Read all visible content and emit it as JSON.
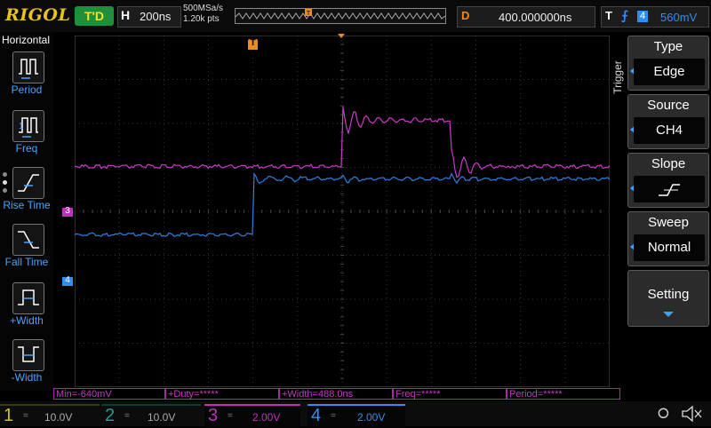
{
  "header": {
    "brand": "RIGOL",
    "run_status": "T'D",
    "timebase_label": "H",
    "timebase_value": "200ns",
    "sample_rate": "500MSa/s",
    "memory_depth": "1.20k pts",
    "delay_label": "D",
    "delay_value": "400.000000ns",
    "trigger_label": "T",
    "trigger_source_badge": "4",
    "trigger_level": "560mV"
  },
  "left_menu": {
    "title": "Horizontal",
    "items": [
      {
        "label": "Period",
        "icon": "period-icon"
      },
      {
        "label": "Freq",
        "icon": "frequency-icon"
      },
      {
        "label": "Rise Time",
        "icon": "rise-time-icon"
      },
      {
        "label": "Fall Time",
        "icon": "fall-time-icon"
      },
      {
        "label": "+Width",
        "icon": "positive-width-icon"
      },
      {
        "label": "-Width",
        "icon": "negative-width-icon"
      }
    ]
  },
  "right_menu": {
    "title": "Trigger",
    "items": [
      {
        "title": "Type",
        "value": "Edge"
      },
      {
        "title": "Source",
        "value": "CH4"
      },
      {
        "title": "Slope",
        "value": ""
      },
      {
        "title": "Sweep",
        "value": "Normal"
      },
      {
        "title": "Setting",
        "value": ""
      }
    ]
  },
  "markers": {
    "trigger_position": "T",
    "channel3": "3",
    "channel4": "4"
  },
  "measurements": [
    {
      "text": "Min=-640mV"
    },
    {
      "text": "+Duty=*****"
    },
    {
      "text": "+Width=488.0ns"
    },
    {
      "text": "Freq=*****"
    },
    {
      "text": "Period=*****"
    }
  ],
  "channels": [
    {
      "num": "1",
      "coupling": "=",
      "scale": "10.0V",
      "color": "#c8c800",
      "active": false
    },
    {
      "num": "2",
      "coupling": "=",
      "scale": "10.0V",
      "color": "#1fa090",
      "active": false
    },
    {
      "num": "3",
      "coupling": "=",
      "scale": "2.00V",
      "color": "#c030c0",
      "active": true
    },
    {
      "num": "4",
      "coupling": "=",
      "scale": "2.00V",
      "color": "#2f8ff0",
      "active": true
    }
  ],
  "colors": {
    "ch3_trace": "#c83cc8",
    "ch4_trace": "#2f7fe0",
    "trigger_marker": "#f08a1c",
    "brand": "#e8c21c"
  },
  "chart_data": {
    "type": "line",
    "xlabel": "",
    "ylabel": "",
    "x_units": "divisions from left edge",
    "y_units": "divisions from center",
    "xlim": [
      0,
      12
    ],
    "ylim": [
      -4,
      4
    ],
    "grid": true,
    "series": [
      {
        "name": "",
        "color": "#c83cc8",
        "points": [
          [
            0,
            1
          ],
          [
            6,
            1
          ],
          [
            6.02,
            2.2
          ],
          [
            6.1,
            2.1
          ],
          [
            8.4,
            2.05
          ],
          [
            8.45,
            1.0
          ],
          [
            12,
            1.0
          ]
        ],
        "baseline": 1.0,
        "high": 2.05
      },
      {
        "name": "",
        "color": "#2f7fe0",
        "points": [
          [
            0,
            -0.55
          ],
          [
            4,
            -0.55
          ],
          [
            4.05,
            0.72
          ],
          [
            12,
            0.72
          ]
        ],
        "baseline": -0.55,
        "high": 0.72
      }
    ]
  }
}
